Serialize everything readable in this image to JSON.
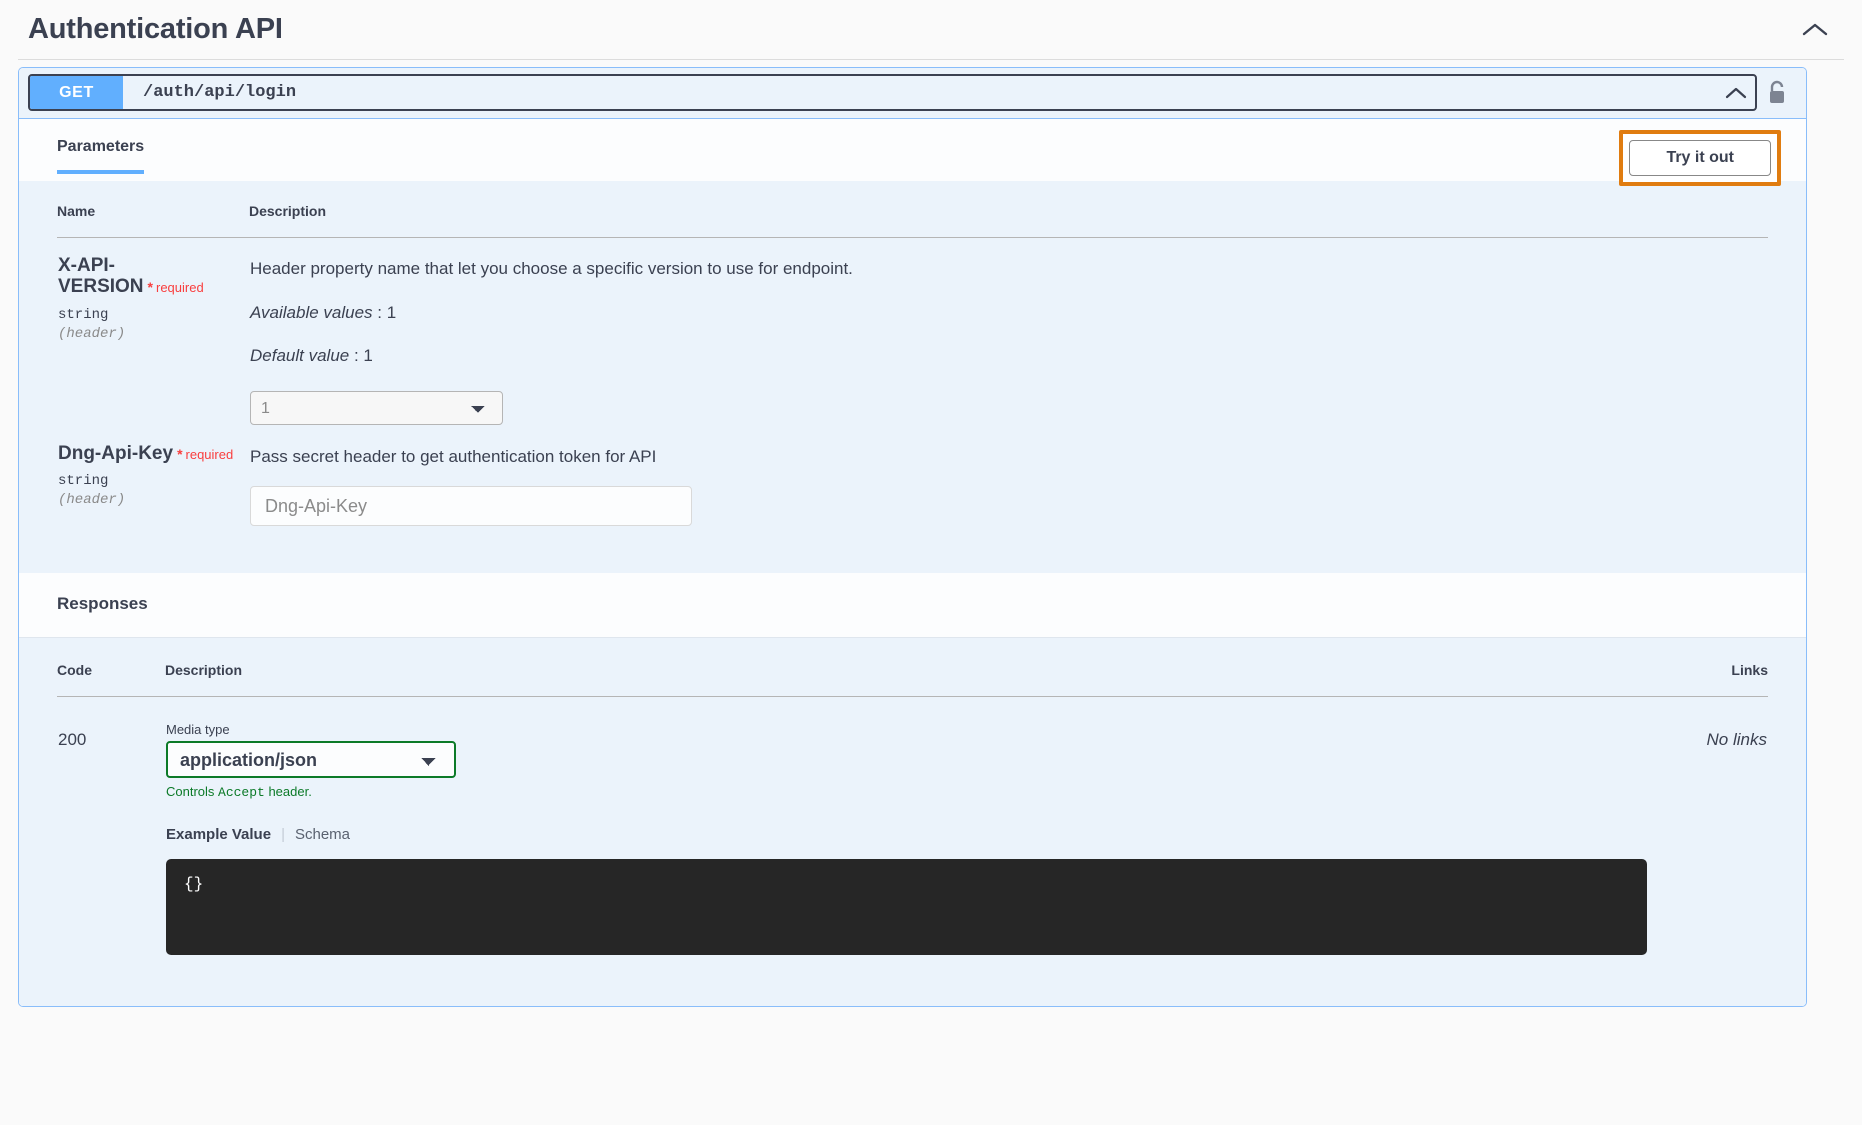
{
  "tag": {
    "title": "Authentication API",
    "collapse_icon": "chevron-up-icon"
  },
  "operation": {
    "method": "GET",
    "path": "/auth/api/login",
    "collapse_icon": "chevron-up-icon",
    "auth_icon": "unlocked-padlock-icon"
  },
  "tabs": [
    {
      "label": "Parameters",
      "active": true
    }
  ],
  "try_it_out": {
    "label": "Try it out",
    "highlight_color": "#e07c10"
  },
  "parameters": {
    "headers": {
      "name": "Name",
      "description": "Description"
    },
    "rows": [
      {
        "name": "X-API-VERSION",
        "required_star": "*",
        "required_label": "required",
        "type": "string",
        "location": "(header)",
        "description": "Header property name that let you choose a specific version to use for endpoint.",
        "available_values_label": "Available values",
        "available_values": "1",
        "default_value_label": "Default value",
        "default_value": "1",
        "control": "select",
        "select_value": "1",
        "select_options": [
          "1"
        ]
      },
      {
        "name": "Dng-Api-Key",
        "required_star": "*",
        "required_label": "required",
        "type": "string",
        "location": "(header)",
        "description": "Pass secret header to get authentication token for API",
        "control": "input",
        "input_value": "",
        "input_placeholder": "Dng-Api-Key"
      }
    ]
  },
  "responses": {
    "title": "Responses",
    "headers": {
      "code": "Code",
      "description": "Description",
      "links": "Links"
    },
    "rows": [
      {
        "code": "200",
        "media_type_label": "Media type",
        "media_type_value": "application/json",
        "media_type_options": [
          "application/json"
        ],
        "media_type_border_color": "#0c7a28",
        "controls_note_prefix": "Controls ",
        "controls_note_code": "Accept",
        "controls_note_suffix": " header.",
        "example_tab_active": "Example Value",
        "example_tab_other": "Schema",
        "example_body": "{}",
        "links": "No links"
      }
    ]
  },
  "colors": {
    "get_method": "#61affe",
    "panel_bg": "#ebf3fb",
    "panel_border": "#89bdfa",
    "required_red": "#f93e3e",
    "green_accent": "#0c7a28",
    "code_bg": "#262626"
  }
}
